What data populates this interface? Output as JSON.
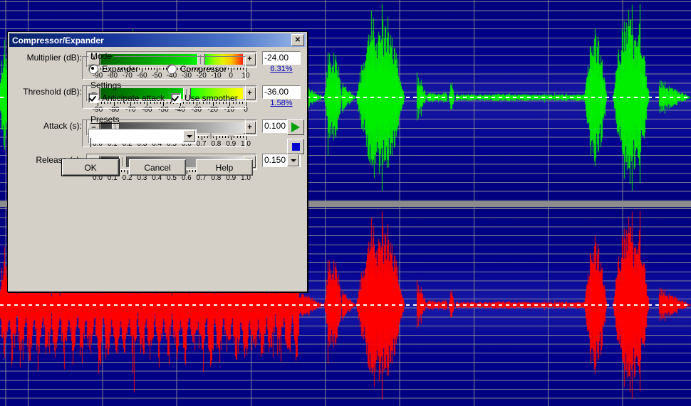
{
  "app": {
    "background": {
      "name": "waveform-editor",
      "wave_color_top": "#00ee00",
      "wave_color_bottom": "#ff0000",
      "background_color": "#000080",
      "grid_color": "#969696",
      "separator_color": "#8c8c8c"
    }
  },
  "dialog": {
    "title": "Compressor/Expander",
    "close_label": "✕",
    "controls": [
      {
        "label": "Multiplier (dB):",
        "value": "-24.00",
        "percent": "6.31%",
        "has_dropdown": false,
        "thumb_pct": 70.0,
        "track_style": "multiplier",
        "ticks": [
          "-90",
          "-80",
          "-70",
          "-60",
          "-50",
          "-40",
          "-30",
          "-20",
          "-10",
          "0",
          "10"
        ]
      },
      {
        "label": "Threshold (dB):",
        "value": "-36.00",
        "percent": "1.58%",
        "has_dropdown": false,
        "thumb_pct": 60.0,
        "track_style": "threshold",
        "ticks": [
          "-90",
          "-80",
          "-70",
          "-60",
          "-50",
          "-40",
          "-30",
          "-20",
          "-10",
          "0"
        ]
      },
      {
        "label": "Attack (s):",
        "value": "0.100",
        "percent": "",
        "has_dropdown": true,
        "thumb_pct": 10.0,
        "track_style": "gray",
        "ticks": [
          "0.0",
          "0.1",
          "0.2",
          "0.3",
          "0.4",
          "0.5",
          "0.6",
          "0.7",
          "0.8",
          "0.9",
          "1.0"
        ]
      },
      {
        "label": "Release (s):",
        "value": "0.150",
        "percent": "",
        "has_dropdown": true,
        "thumb_pct": 15.0,
        "track_style": "gray",
        "ticks": [
          "0.0",
          "0.1",
          "0.2",
          "0.3",
          "0.4",
          "0.5",
          "0.6",
          "0.7",
          "0.8",
          "0.9",
          "1.0"
        ]
      }
    ],
    "mode": {
      "legend": "Mode",
      "options": [
        {
          "label": "Expander",
          "checked": true
        },
        {
          "label": "Compressor",
          "checked": false
        }
      ]
    },
    "settings": {
      "legend": "Settings",
      "options": [
        {
          "label": "Anticipate attack",
          "checked": true
        },
        {
          "label": "Use smoother",
          "checked": true
        }
      ]
    },
    "presets": {
      "legend": "Presets",
      "value": "",
      "add_label": "+",
      "remove_label": "−",
      "play_icon": "play-icon",
      "stop_icon": "stop-icon"
    },
    "buttons": [
      {
        "label": "OK",
        "default": true
      },
      {
        "label": "Cancel",
        "default": false
      },
      {
        "label": "Help",
        "default": false
      }
    ]
  }
}
